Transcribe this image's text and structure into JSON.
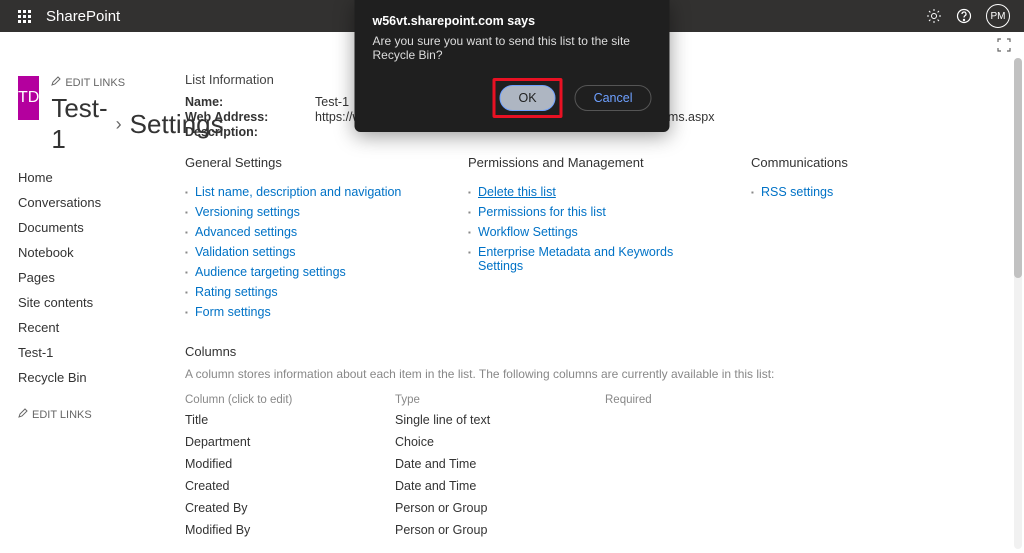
{
  "suitebar": {
    "brand": "SharePoint",
    "avatar_initials": "PM"
  },
  "site": {
    "logo_initials": "TD",
    "edit_links_label": "EDIT LINKS",
    "breadcrumb_site": "Test-1",
    "breadcrumb_page": "Settings"
  },
  "nav": {
    "items": [
      "Home",
      "Conversations",
      "Documents",
      "Notebook",
      "Pages",
      "Site contents",
      "Recent",
      "Test-1",
      "Recycle Bin"
    ],
    "edit_links_label": "EDIT LINKS"
  },
  "listinfo": {
    "heading": "List Information",
    "name_label": "Name:",
    "name_value": "Test-1",
    "web_label": "Web Address:",
    "web_value": "https://w56vt.sharepoint.com/sites/TestDemo-1/Lists/Test1/AllItems.aspx",
    "desc_label": "Description:",
    "desc_value": ""
  },
  "settings_groups": {
    "general": {
      "heading": "General Settings",
      "links": [
        "List name, description and navigation",
        "Versioning settings",
        "Advanced settings",
        "Validation settings",
        "Audience targeting settings",
        "Rating settings",
        "Form settings"
      ]
    },
    "permissions": {
      "heading": "Permissions and Management",
      "links": [
        "Delete this list",
        "Permissions for this list",
        "Workflow Settings",
        "Enterprise Metadata and Keywords Settings"
      ]
    },
    "comm": {
      "heading": "Communications",
      "links": [
        "RSS settings"
      ]
    }
  },
  "columns": {
    "heading": "Columns",
    "description": "A column stores information about each item in the list. The following columns are currently available in this list:",
    "head_col": "Column (click to edit)",
    "head_type": "Type",
    "head_req": "Required",
    "rows": [
      {
        "name": "Title",
        "type": "Single line of text",
        "req": ""
      },
      {
        "name": "Department",
        "type": "Choice",
        "req": ""
      },
      {
        "name": "Modified",
        "type": "Date and Time",
        "req": ""
      },
      {
        "name": "Created",
        "type": "Date and Time",
        "req": ""
      },
      {
        "name": "Created By",
        "type": "Person or Group",
        "req": ""
      },
      {
        "name": "Modified By",
        "type": "Person or Group",
        "req": ""
      }
    ]
  },
  "dialog": {
    "title": "w56vt.sharepoint.com says",
    "message": "Are you sure you want to send this list to the site Recycle Bin?",
    "ok": "OK",
    "cancel": "Cancel"
  }
}
